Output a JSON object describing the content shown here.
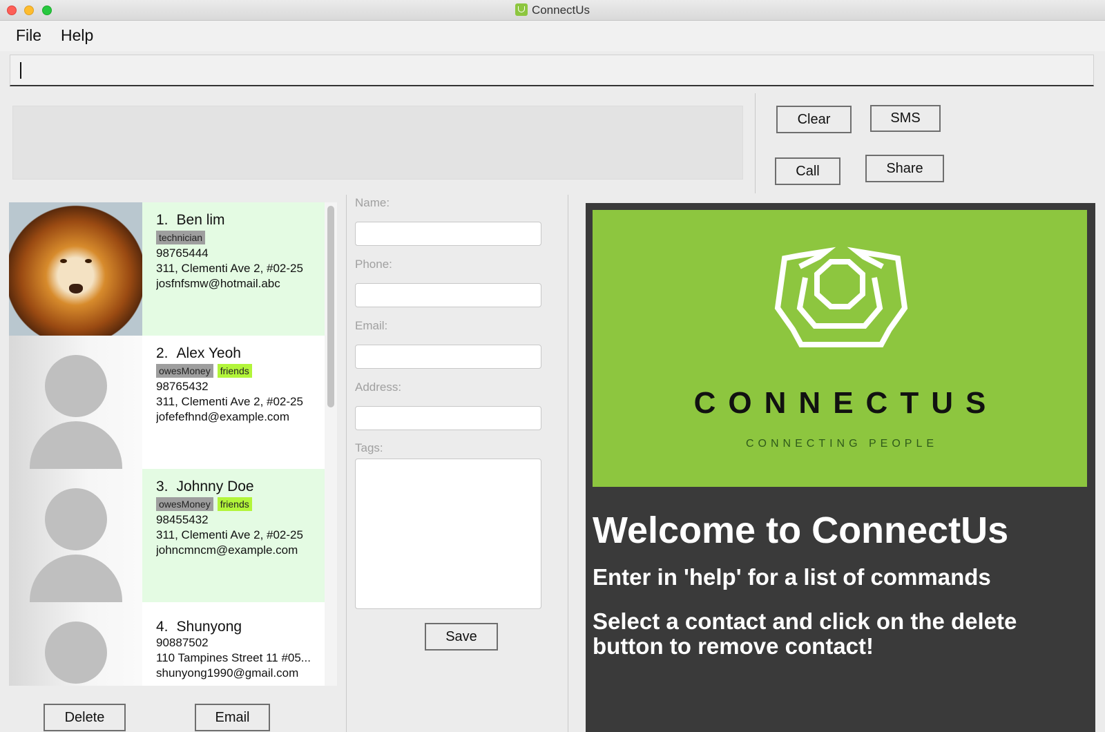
{
  "window": {
    "title": "ConnectUs"
  },
  "menu": {
    "file": "File",
    "help": "Help"
  },
  "command": {
    "value": ""
  },
  "buttons": {
    "clear": "Clear",
    "sms": "SMS",
    "call": "Call",
    "share": "Share",
    "delete": "Delete",
    "email": "Email",
    "save": "Save"
  },
  "persons": [
    {
      "index": "1.",
      "name": "Ben lim",
      "tags": [
        "technician"
      ],
      "phone": "98765444",
      "address": "311, Clementi Ave 2, #02-25",
      "email": "josfnfsmw@hotmail.abc",
      "avatar": "lion-photo"
    },
    {
      "index": "2.",
      "name": "Alex Yeoh",
      "tags": [
        "owesMoney",
        "friends"
      ],
      "phone": "98765432",
      "address": "311, Clementi Ave 2, #02-25",
      "email": "jofefefhnd@example.com",
      "avatar": "default-avatar"
    },
    {
      "index": "3.",
      "name": "Johnny Doe",
      "tags": [
        "owesMoney",
        "friends"
      ],
      "phone": "98455432",
      "address": "311, Clementi Ave 2, #02-25",
      "email": "johncmncm@example.com",
      "avatar": "default-avatar"
    },
    {
      "index": "4.",
      "name": "Shunyong",
      "tags": [],
      "phone": "90887502",
      "address": "110 Tampines Street 11 #05...",
      "email": "shunyong1990@gmail.com",
      "avatar": "default-avatar"
    }
  ],
  "form": {
    "name_label": "Name:",
    "phone_label": "Phone:",
    "email_label": "Email:",
    "address_label": "Address:",
    "tags_label": "Tags:"
  },
  "welcome": {
    "logo_text": "CONNECTUS",
    "logo_tagline": "CONNECTING PEOPLE",
    "title": "Welcome to ConnectUs",
    "line1": "Enter in 'help' for a list of commands",
    "line2": "Select a contact and click on the delete button to remove contact!"
  },
  "colors": {
    "brand_green": "#8dc63f",
    "selected_card": "#e4fbe3",
    "tag_grey": "#9e9e9e",
    "tag_lime": "#b2f53a",
    "welcome_bg": "#3a3a3a"
  }
}
